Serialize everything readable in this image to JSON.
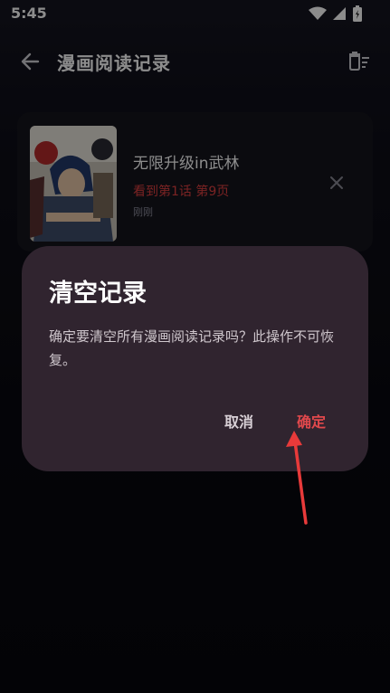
{
  "status_bar": {
    "time": "5:45"
  },
  "header": {
    "title": "漫画阅读记录"
  },
  "history": [
    {
      "title": "无限升级in武林",
      "progress": "看到第1话 第9页",
      "time": "刚刚"
    }
  ],
  "dialog": {
    "title": "清空记录",
    "message": "确定要清空所有漫画阅读记录吗？此操作不可恢复。",
    "cancel_label": "取消",
    "confirm_label": "确定"
  },
  "colors": {
    "background": "#0b0b12",
    "dialog_background": "#30242f",
    "accent_red": "#e0484c",
    "annotation_arrow": "#e83a3a"
  }
}
